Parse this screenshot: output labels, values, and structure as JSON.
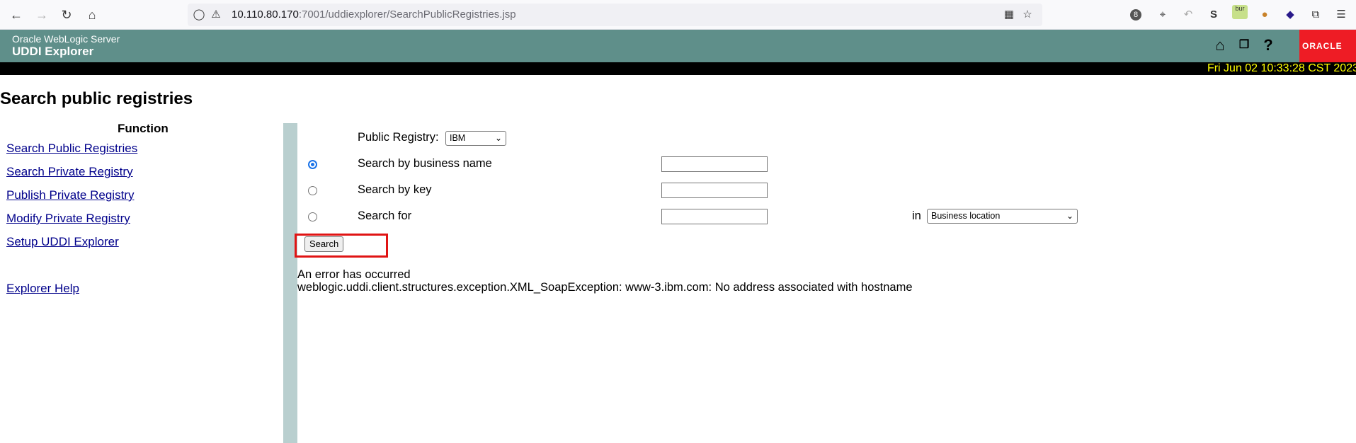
{
  "browser": {
    "url_host": "10.110.80.170",
    "url_rest": ":7001/uddiexplorer/SearchPublicRegistries.jsp",
    "ext_badge": "8",
    "ext_bur": "bur"
  },
  "header": {
    "product": "Oracle WebLogic Server",
    "app": "UDDI Explorer",
    "logo_text": "ORACLE",
    "datetime": "Fri Jun 02 10:33:28 CST 2023"
  },
  "page": {
    "title": "Search public registries"
  },
  "sidebar": {
    "heading": "Function",
    "links": [
      "Search Public Registries",
      "Search Private Registry",
      "Publish Private Registry",
      "Modify Private Registry",
      "Setup UDDI Explorer",
      "Explorer Help"
    ]
  },
  "form": {
    "registry_label": "Public Registry:",
    "registry_value": "IBM",
    "options": [
      {
        "label": "Search by business name",
        "checked": true
      },
      {
        "label": "Search by key",
        "checked": false
      },
      {
        "label": "Search for",
        "checked": false
      }
    ],
    "in_label": "in",
    "in_value": "Business location",
    "search_button": "Search"
  },
  "error": {
    "line1": "An error has occurred",
    "line2": "weblogic.uddi.client.structures.exception.XML_SoapException: www-3.ibm.com: No address associated with hostname"
  }
}
